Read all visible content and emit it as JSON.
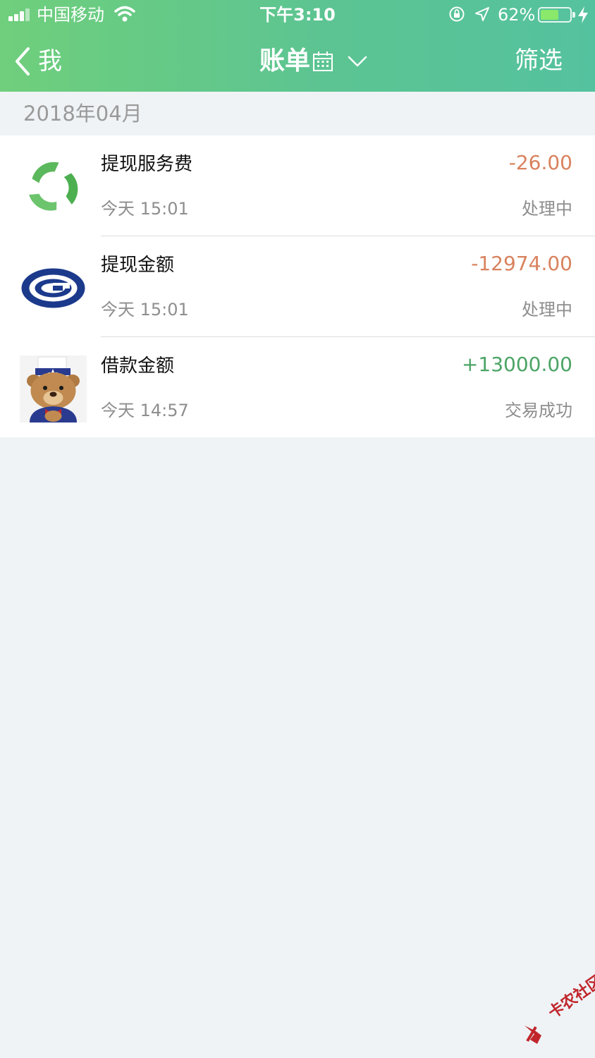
{
  "status_bar": {
    "carrier": "中国移动",
    "time": "下午3:10",
    "battery_percent": "62%",
    "battery_level": 0.62,
    "icons": [
      "signal-icon",
      "wifi-icon",
      "rotation-lock-icon",
      "location-icon",
      "battery-icon",
      "charging-icon"
    ]
  },
  "nav": {
    "back_label": "我",
    "title": "账单",
    "filter_label": "筛选",
    "icons": [
      "back-chevron-icon",
      "calendar-icon",
      "chevron-down-icon"
    ]
  },
  "month_header": "2018年04月",
  "transactions": [
    {
      "title": "提现服务费",
      "time": "今天 15:01",
      "amount": "-26.00",
      "status": "处理中",
      "logo": "green-cycle-logo-icon"
    },
    {
      "title": "提现金额",
      "time": "今天 15:01",
      "amount": "-12974.00",
      "status": "处理中",
      "logo": "blue-g-logo-icon"
    },
    {
      "title": "借款金额",
      "time": "今天 14:57",
      "amount": "+13000.00",
      "status": "交易成功",
      "logo": "bear-avatar-icon"
    }
  ],
  "colors": {
    "header_start": "#6fcf7c",
    "header_end": "#55c29f",
    "negative_amount": "#d9825e",
    "positive_amount": "#4da466",
    "page_background": "#eff3f6"
  },
  "watermark": "卡农社区"
}
